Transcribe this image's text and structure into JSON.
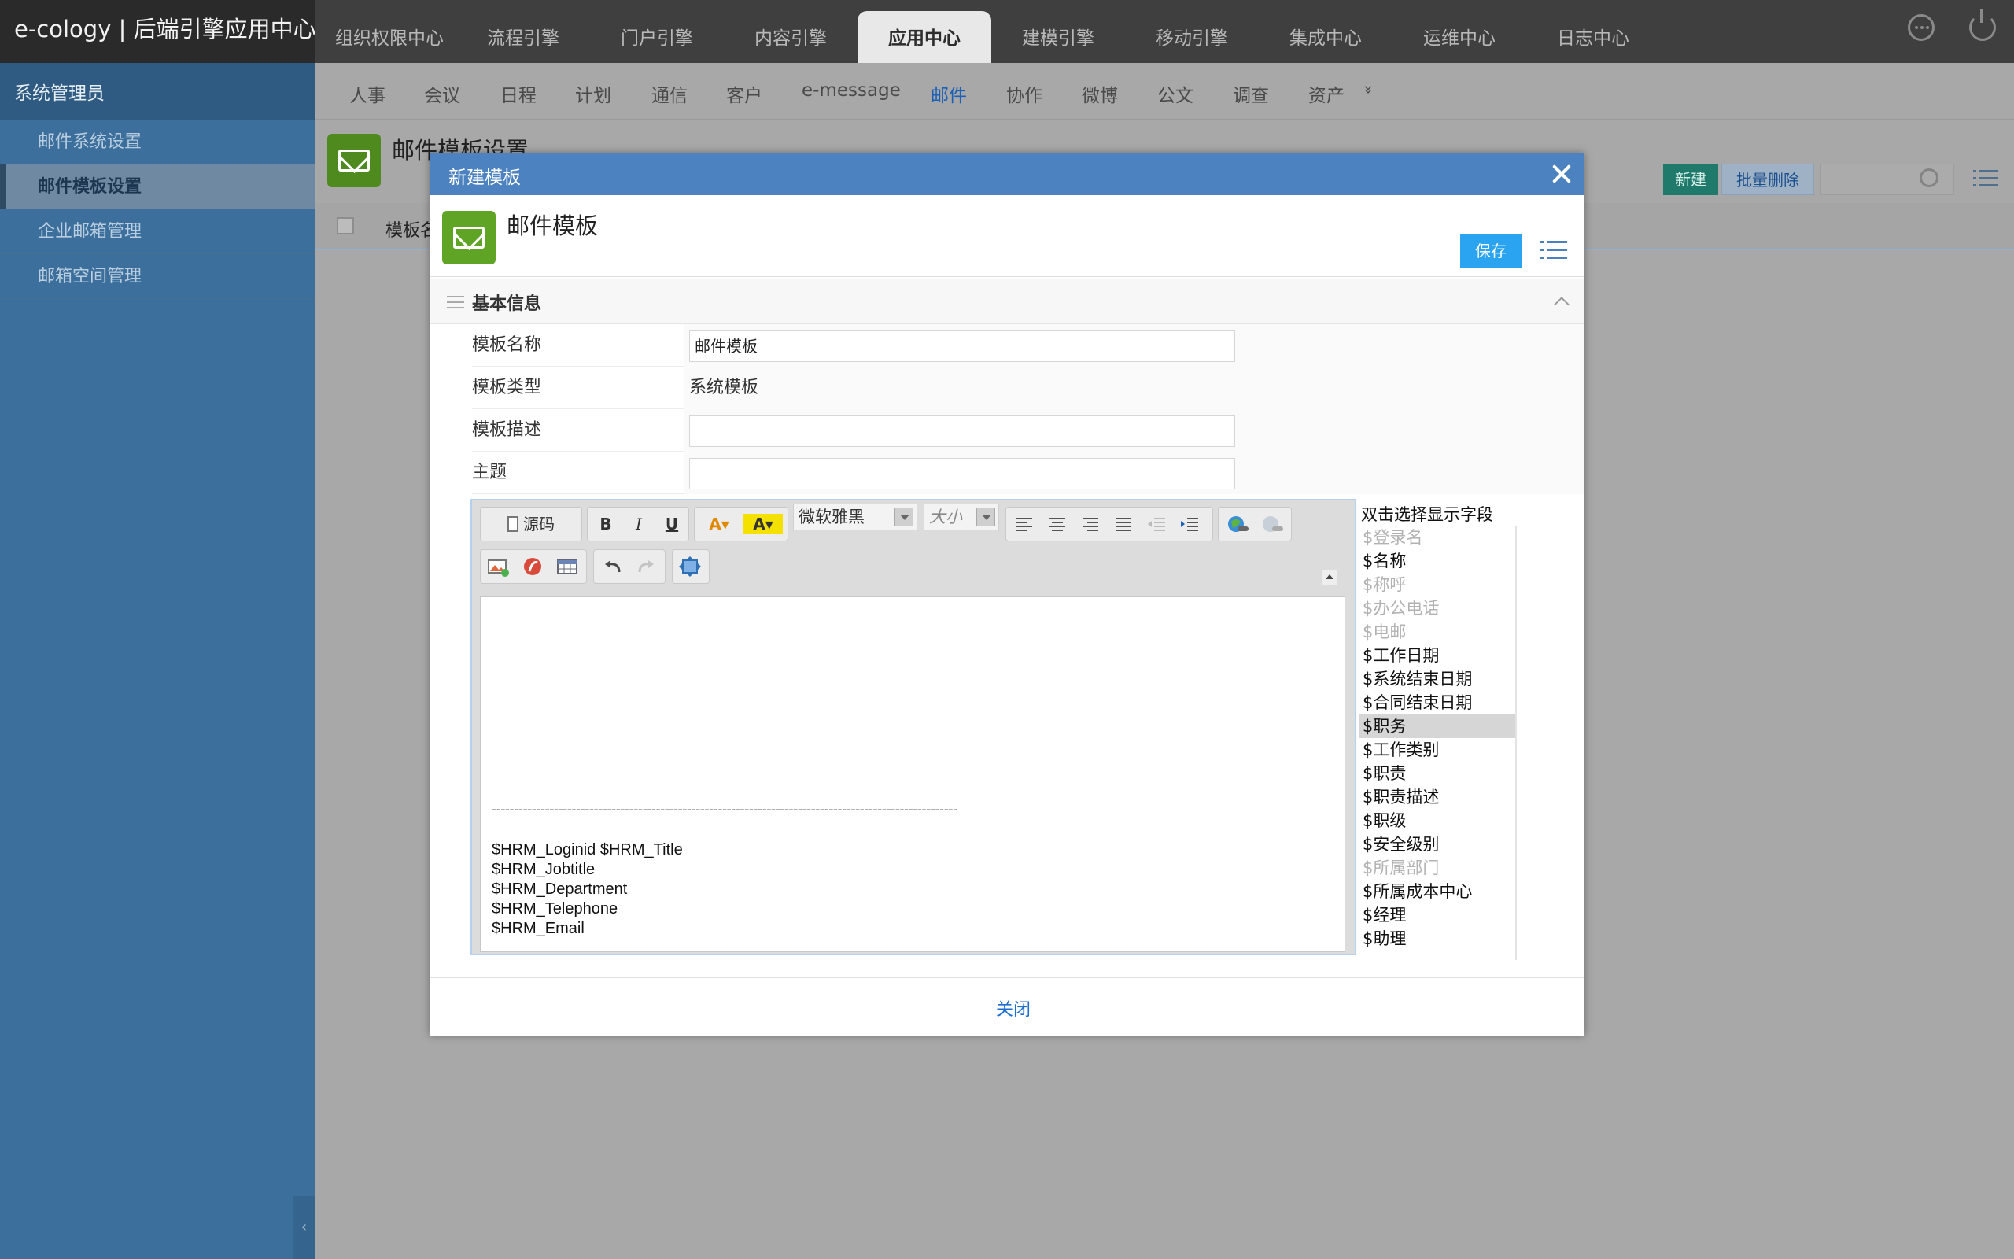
{
  "app": {
    "title": "e-cology | 后端引擎应用中心"
  },
  "top_tabs": [
    {
      "label": "组织权限中心"
    },
    {
      "label": "流程引擎"
    },
    {
      "label": "门户引擎"
    },
    {
      "label": "内容引擎"
    },
    {
      "label": "应用中心",
      "active": true
    },
    {
      "label": "建模引擎"
    },
    {
      "label": "移动引擎"
    },
    {
      "label": "集成中心"
    },
    {
      "label": "运维中心"
    },
    {
      "label": "日志中心"
    }
  ],
  "sidebar": {
    "header": "系统管理员",
    "items": [
      {
        "label": "邮件系统设置"
      },
      {
        "label": "邮件模板设置",
        "active": true
      },
      {
        "label": "企业邮箱管理"
      },
      {
        "label": "邮箱空间管理"
      }
    ],
    "collapse_icon": "‹"
  },
  "sub_nav": [
    {
      "label": "人事"
    },
    {
      "label": "会议"
    },
    {
      "label": "日程"
    },
    {
      "label": "计划"
    },
    {
      "label": "通信"
    },
    {
      "label": "客户"
    },
    {
      "label": "e-message"
    },
    {
      "label": "邮件",
      "active": true
    },
    {
      "label": "协作"
    },
    {
      "label": "微博"
    },
    {
      "label": "公文"
    },
    {
      "label": "调查"
    },
    {
      "label": "资产"
    },
    {
      "label": "»",
      "icon": "double-chevron-down-icon"
    }
  ],
  "page": {
    "title": "邮件模板设置",
    "new_button": "新建",
    "batch_delete_button": "批量删除",
    "table_column_partial": "模板名"
  },
  "dialog": {
    "title": "新建模板",
    "heading": "邮件模板",
    "save_button": "保存",
    "section_title": "基本信息",
    "fields": {
      "name_label": "模板名称",
      "name_value": "邮件模板",
      "type_label": "模板类型",
      "type_value": "系统模板",
      "desc_label": "模板描述",
      "desc_value": "",
      "subject_label": "主题",
      "subject_value": ""
    },
    "close_link": "关闭"
  },
  "editor": {
    "toolbar": {
      "source_label": "源码",
      "bold": "B",
      "italic": "I",
      "underline": "U",
      "font_family": "微软雅黑",
      "font_size": "大小"
    },
    "separator": "---------------------------------------------------------------------------------------------------------",
    "signature_lines": [
      "$HRM_Loginid $HRM_Title",
      "$HRM_Jobtitle",
      "$HRM_Department",
      "$HRM_Telephone",
      "$HRM_Email"
    ]
  },
  "field_picker": {
    "title": "双击选择显示字段",
    "items": [
      {
        "label": "$登录名",
        "disabled": true
      },
      {
        "label": "$名称"
      },
      {
        "label": "$称呼",
        "disabled": true
      },
      {
        "label": "$办公电话",
        "disabled": true
      },
      {
        "label": "$电邮",
        "disabled": true
      },
      {
        "label": "$工作日期"
      },
      {
        "label": "$系统结束日期"
      },
      {
        "label": "$合同结束日期"
      },
      {
        "label": "$职务",
        "selected": true
      },
      {
        "label": "$工作类别"
      },
      {
        "label": "$职责"
      },
      {
        "label": "$职责描述"
      },
      {
        "label": "$职级"
      },
      {
        "label": "$安全级别"
      },
      {
        "label": "$所属部门",
        "disabled": true
      },
      {
        "label": "$所属成本中心"
      },
      {
        "label": "$经理"
      },
      {
        "label": "$助理"
      }
    ]
  },
  "colors": {
    "accent": "#4b82bf",
    "save_button": "#2aa4f0",
    "icon_green": "#5fa425",
    "sidebar": "#3c6f9b",
    "active_subnav": "#1c61b5"
  }
}
